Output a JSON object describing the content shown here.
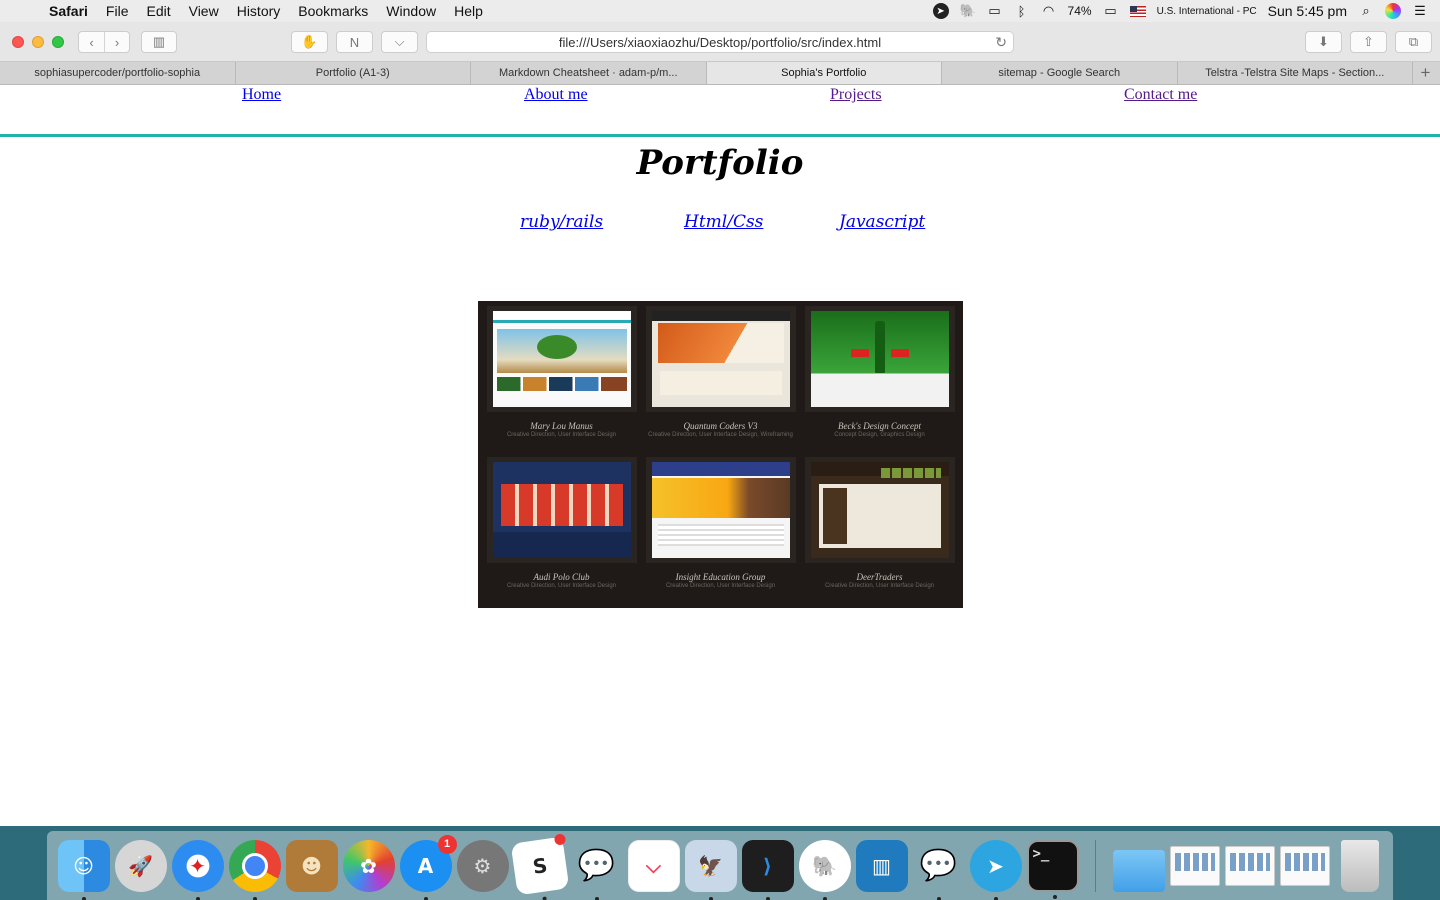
{
  "menubar": {
    "app": "Safari",
    "menus": [
      "File",
      "Edit",
      "View",
      "History",
      "Bookmarks",
      "Window",
      "Help"
    ],
    "battery": "74%",
    "input_source": "U.S. International - PC",
    "clock": "Sun 5:45 pm"
  },
  "toolbar": {
    "url": "file:///Users/xiaoxiaozhu/Desktop/portfolio/src/index.html"
  },
  "tabs": [
    {
      "label": "sophiasupercoder/portfolio-sophia"
    },
    {
      "label": "Portfolio (A1-3)"
    },
    {
      "label": "Markdown Cheatsheet · adam-p/m..."
    },
    {
      "label": "Sophia's Portfolio",
      "active": true
    },
    {
      "label": "sitemap - Google Search"
    },
    {
      "label": "Telstra -Telstra Site Maps - Section..."
    }
  ],
  "page": {
    "nav": {
      "home": "Home",
      "about": "About me",
      "projects": "Projects",
      "contact": "Contact me"
    },
    "title": "Portfolio",
    "categories": [
      "ruby/rails",
      "Html/Css",
      "Javascript"
    ],
    "projects": [
      {
        "name": "Mary Lou Manus",
        "roles": "Creative Direction, User Interface Design"
      },
      {
        "name": "Quantum Coders V3",
        "roles": "Creative Direction, User Interface Design, Wireframing"
      },
      {
        "name": "Beck's Design Concept",
        "roles": "Concept Design, Graphics Design"
      },
      {
        "name": "Audi Polo Club",
        "roles": "Creative Direction, User Interface Design"
      },
      {
        "name": "Insight Education Group",
        "roles": "Creative Direction, User Interface Design"
      },
      {
        "name": "DeerTraders",
        "roles": "Creative Direction, User Interface Design"
      }
    ]
  },
  "dock": {
    "app_store_badge": "1",
    "terminal_prompt": ">_"
  },
  "colors": {
    "accent": "#20b2aa",
    "link": "#0000ee",
    "visited": "#551a8b"
  }
}
